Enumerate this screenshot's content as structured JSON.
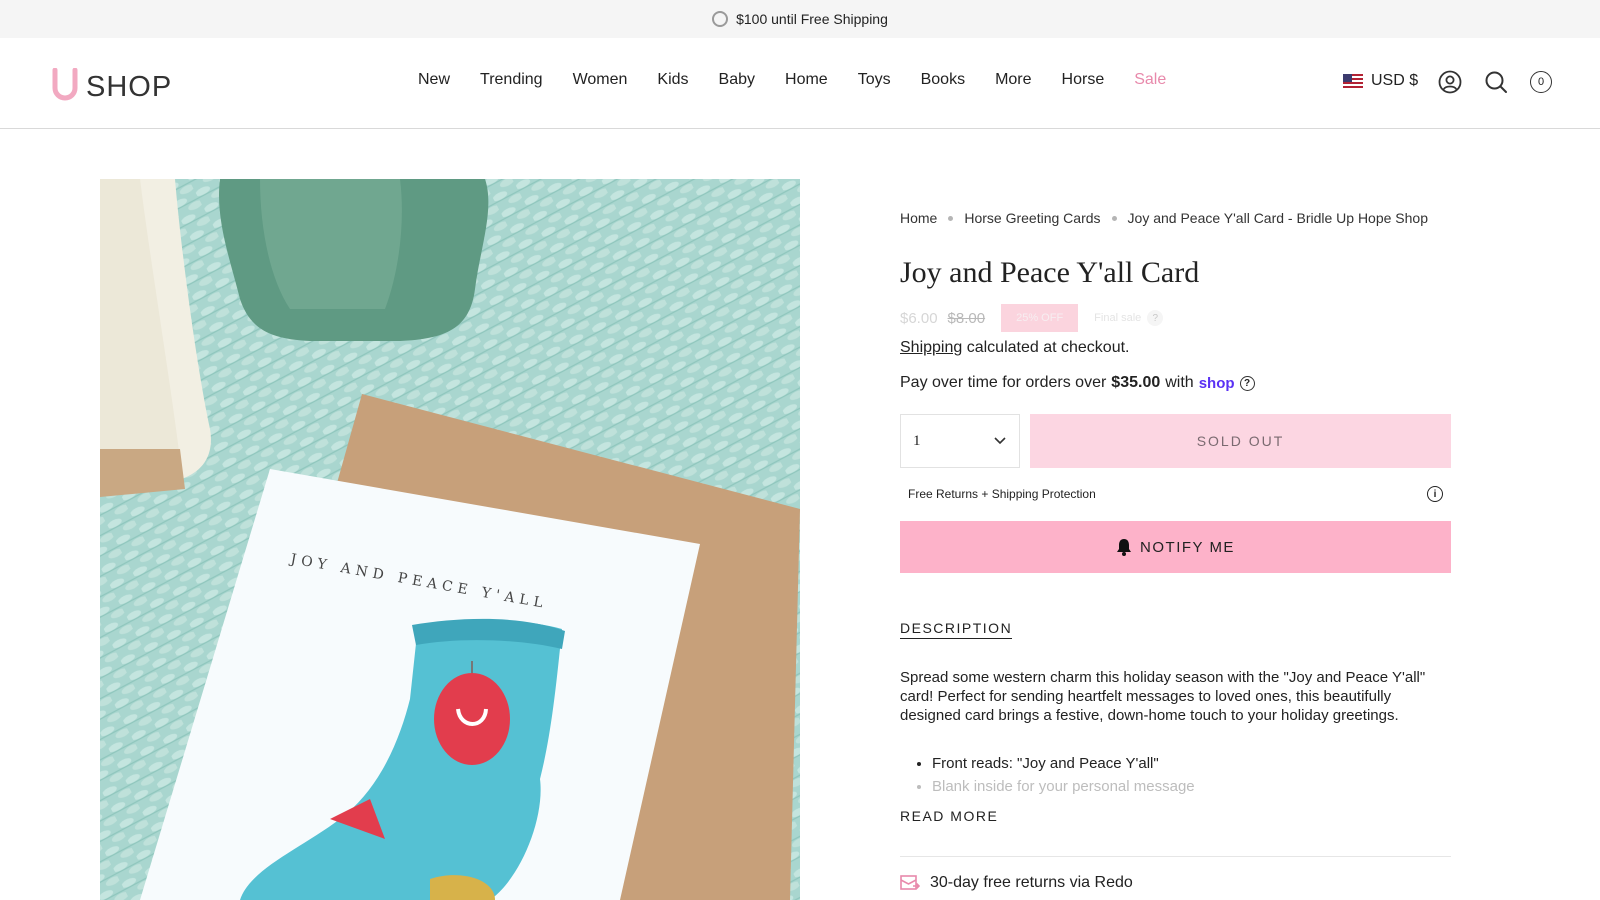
{
  "announcement": {
    "text": "$100 until Free Shipping"
  },
  "header": {
    "logo_text": "SHOP",
    "nav": [
      {
        "label": "New"
      },
      {
        "label": "Trending"
      },
      {
        "label": "Women"
      },
      {
        "label": "Kids"
      },
      {
        "label": "Baby"
      },
      {
        "label": "Home"
      },
      {
        "label": "Toys"
      },
      {
        "label": "Books"
      },
      {
        "label": "More"
      },
      {
        "label": "Horse"
      },
      {
        "label": "Sale"
      }
    ],
    "currency": "USD $",
    "cart_count": "0"
  },
  "product_image": {
    "card_text": "JOY AND PEACE Y'ALL"
  },
  "breadcrumb": [
    "Home",
    "Horse Greeting Cards",
    "Joy and Peace Y'all Card - Bridle Up Hope Shop"
  ],
  "product": {
    "title": "Joy and Peace Y'all Card",
    "price": "$6.00",
    "compare_price": "$8.00",
    "discount_badge": "25% OFF",
    "final_sale": "Final sale",
    "final_sale_q": "?",
    "shipping_link": "Shipping",
    "shipping_rest": " calculated at checkout.",
    "installments_pre": "Pay over time for orders over",
    "installments_amount": "$35.00",
    "installments_with": "with",
    "installments_brand": "shop",
    "installments_help": "?",
    "quantity": "1",
    "sold_out_label": "SOLD OUT",
    "protection_label": "Free Returns + Shipping Protection",
    "protection_info": "i",
    "notify_label": "NOTIFY ME"
  },
  "description": {
    "tab_label": "DESCRIPTION",
    "body": "Spread some western charm this holiday season with the \"Joy and Peace Y'all\" card! Perfect for sending heartfelt messages to loved ones, this beautifully designed card brings a festive, down-home touch to your holiday greetings.",
    "bullets": [
      "Front reads: \"Joy and Peace Y'all\"",
      "Blank inside for your personal message"
    ],
    "read_more": "READ MORE"
  },
  "returns": {
    "text": "30-day free returns via Redo"
  },
  "colors": {
    "accent_pink": "#fdb2c9",
    "sale_pink": "#e889ab",
    "shop_purple": "#5a31f4"
  }
}
